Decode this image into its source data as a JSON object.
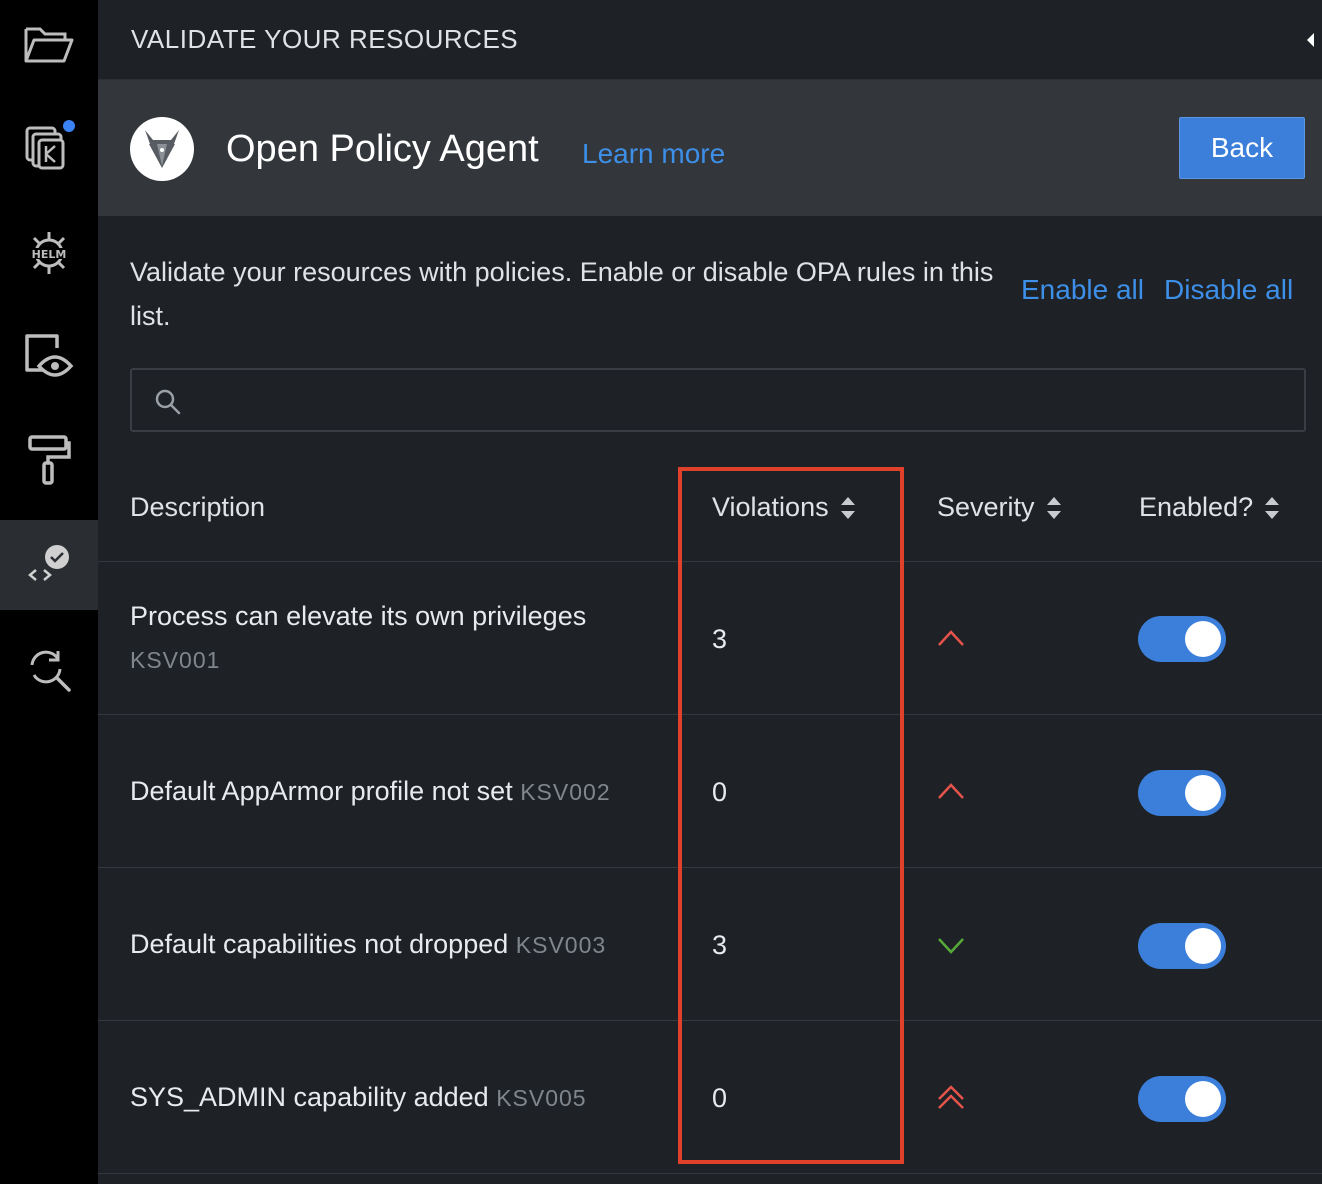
{
  "activity_bar": {
    "items": [
      {
        "icon": "folder-icon"
      },
      {
        "icon": "kubernetes-resources-icon",
        "badge_color": "#3b82f6"
      },
      {
        "icon": "helm-icon"
      },
      {
        "icon": "preview-icon"
      },
      {
        "icon": "paint-roller-icon"
      },
      {
        "icon": "validation-icon",
        "active": true
      },
      {
        "icon": "search-refresh-icon"
      }
    ]
  },
  "panel": {
    "title": "VALIDATE YOUR RESOURCES"
  },
  "header": {
    "title": "Open Policy Agent",
    "learn_more": "Learn more",
    "back_label": "Back"
  },
  "description": "Validate your resources with policies. Enable or disable OPA rules in this list.",
  "actions": {
    "enable_all": "Enable all",
    "disable_all": "Disable all"
  },
  "search": {
    "placeholder": "",
    "value": ""
  },
  "table": {
    "columns": {
      "description": "Description",
      "violations": "Violations",
      "severity": "Severity",
      "enabled": "Enabled?"
    },
    "rows": [
      {
        "description": "Process can elevate its own privileges",
        "id": "KSV001",
        "violations": "3",
        "severity": "medium",
        "enabled": true
      },
      {
        "description": "Default AppArmor profile not set",
        "id": "KSV002",
        "violations": "0",
        "severity": "medium",
        "enabled": true
      },
      {
        "description": "Default capabilities not dropped",
        "id": "KSV003",
        "violations": "3",
        "severity": "low",
        "enabled": true
      },
      {
        "description": "SYS_ADMIN capability added",
        "id": "KSV005",
        "violations": "0",
        "severity": "high",
        "enabled": true
      }
    ]
  },
  "colors": {
    "accent": "#3b7fdb",
    "link": "#3d8fe8",
    "severity_medium": "#e5534b",
    "severity_low": "#57ab3a",
    "highlight": "#e0412b"
  }
}
